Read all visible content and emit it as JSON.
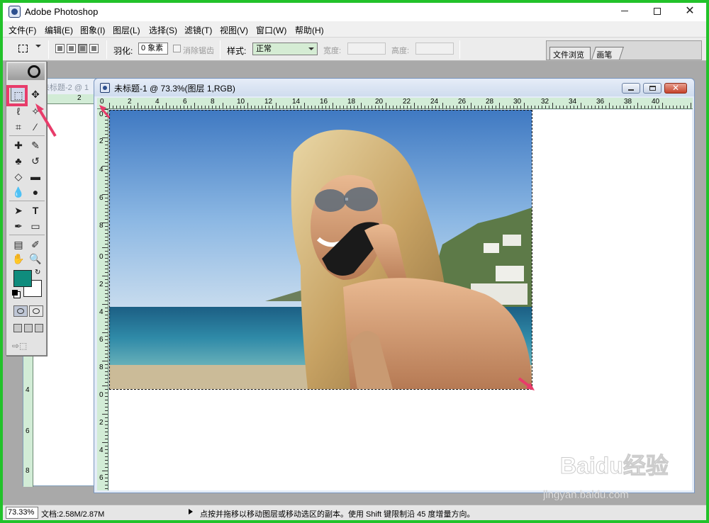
{
  "app": {
    "title": "Adobe Photoshop"
  },
  "menu": [
    "文件(F)",
    "编辑(E)",
    "图象(I)",
    "图层(L)",
    "选择(S)",
    "滤镜(T)",
    "视图(V)",
    "窗口(W)",
    "帮助(H)"
  ],
  "options": {
    "feather_label": "羽化:",
    "feather_value": "0 象素",
    "antialias_label": "消除锯齿",
    "style_label": "样式:",
    "style_value": "正常",
    "width_label": "宽度:",
    "height_label": "高度:"
  },
  "palette_well": {
    "tabs": [
      "文件浏览",
      "画笔"
    ]
  },
  "documents": {
    "background": {
      "title": "未标题-2 @ 1"
    },
    "active": {
      "title": "未标题-1 @ 73.3%(图层 1,RGB)"
    }
  },
  "rulers": {
    "top": [
      "0",
      "2",
      "4",
      "6",
      "8",
      "10",
      "12",
      "14",
      "16",
      "18",
      "20",
      "22",
      "24",
      "26",
      "28",
      "30",
      "32",
      "34",
      "36",
      "38",
      "40"
    ],
    "left": [
      "0",
      "2",
      "4",
      "6",
      "8",
      "0",
      "2",
      "4",
      "6",
      "8",
      "0",
      "2",
      "4",
      "6"
    ],
    "background_top": [
      "2"
    ],
    "background_left": [
      "4",
      "6",
      "8"
    ]
  },
  "status": {
    "zoom": "73.33%",
    "doc_info": "文档:2.58M/2.87M",
    "hint": "点按并拖移以移动图层或移动选区的副本。使用 Shift 键限制沿 45 度增量方向。"
  },
  "watermark": {
    "brand": "Baidu经验",
    "url": "jingyan.baidu.com"
  },
  "colors": {
    "foreground": "#0f8c7d",
    "background": "#ffffff",
    "ruler": "#d2ecd6",
    "frame": "#22c22a",
    "highlight": "#e83c6a"
  },
  "icons": {
    "toolbox": [
      "rect-marquee-icon",
      "move-icon",
      "lasso-icon",
      "magic-wand-icon",
      "crop-icon",
      "slice-icon",
      "healing-brush-icon",
      "brush-icon",
      "clone-stamp-icon",
      "history-brush-icon",
      "eraser-icon",
      "gradient-icon",
      "blur-icon",
      "dodge-icon",
      "path-select-icon",
      "type-icon",
      "pen-icon",
      "shape-icon",
      "notes-icon",
      "eyedropper-icon",
      "hand-icon",
      "zoom-icon"
    ]
  }
}
